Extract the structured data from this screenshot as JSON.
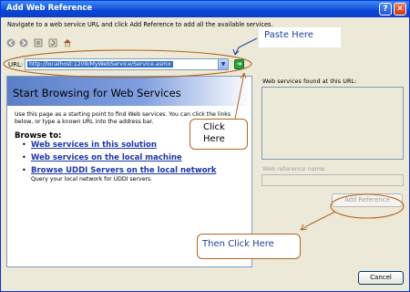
{
  "window": {
    "title": "Add Web Reference",
    "help_glyph": "?",
    "close_glyph": "✕"
  },
  "instruction": "Navigate to a web service URL and click Add Reference to add all the available services.",
  "toolbar": {
    "icons": [
      "back-arrow-icon",
      "forward-arrow-icon",
      "stop-icon",
      "refresh-icon",
      "home-icon"
    ]
  },
  "url": {
    "label": "URL:",
    "value": "http://localhost:1209/MyWebService/Service.asmx",
    "go_glyph": "➜"
  },
  "browser": {
    "heading": "Start Browsing for Web Services",
    "description": "Use this page as a starting point to find Web services. You can click the links below, or type a known URL into the address bar.",
    "browse_to": "Browse to:",
    "links": [
      "Web services in this solution",
      "Web services on the local machine",
      "Browse UDDI Servers on the local network"
    ],
    "uddi_subtext": "Query your local network for UDDI servers."
  },
  "right_panel": {
    "found_label": "Web services found at this URL:",
    "refname_label": "Web reference name:",
    "add_reference_label": "Add Reference"
  },
  "footer": {
    "cancel_label": "Cancel"
  },
  "annotations": {
    "paste_here": "Paste  Here",
    "click_here": "Click Here",
    "then_click_here": "Then Click Here"
  },
  "colors": {
    "titlebar": "#0a46d6",
    "link": "#1c36a8",
    "annotation_outline": "#b5651d",
    "annotation_text": "#1f3f9f"
  }
}
